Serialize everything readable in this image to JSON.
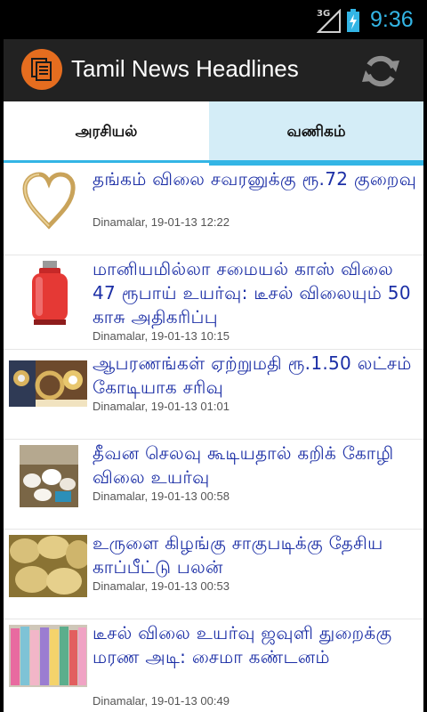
{
  "status_bar": {
    "network": "3G",
    "time": "9:36",
    "accent": "#33b5e5"
  },
  "action_bar": {
    "title": "Tamil News Headlines",
    "app_icon": "newspaper-icon",
    "refresh_icon": "refresh-icon"
  },
  "tabs": [
    {
      "label": "அரசியல்",
      "selected": false
    },
    {
      "label": "வணிகம்",
      "selected": true
    }
  ],
  "news": [
    {
      "headline": "தங்கம் விலை சவரனுக்கு ரூ.72 குறைவு",
      "meta": "Dinamalar, 19-01-13 12:22",
      "thumb": "gold-heart-pendant"
    },
    {
      "headline": "மானியமில்லா சமையல் காஸ் விலை 47 ரூபாய் உயர்வு: டீசல் விலையும் 50 காசு அதிகரிப்பு",
      "meta": "Dinamalar, 19-01-13 10:15",
      "thumb": "lpg-cylinder"
    },
    {
      "headline": "ஆபரணங்கள் ஏற்றுமதி ரூ.1.50 லட்சம் கோடியாக சரிவு",
      "meta": "Dinamalar, 19-01-13 01:01",
      "thumb": "jewellery"
    },
    {
      "headline": "தீவன செலவு கூடியதால் கறிக் கோழி விலை உயர்வு",
      "meta": "Dinamalar, 19-01-13 00:58",
      "thumb": "poultry-farm"
    },
    {
      "headline": "உருளை கிழங்கு சாகுபடிக்கு தேசிய காப்பீட்டு பலன்",
      "meta": "Dinamalar, 19-01-13 00:53",
      "thumb": "potatoes"
    },
    {
      "headline": "டீசல் விலை உயர்வு ஜவுளி துறைக்கு மரண அடி: சைமா கண்டனம்",
      "meta": "Dinamalar, 19-01-13 00:49",
      "thumb": "textile-fabrics"
    }
  ]
}
